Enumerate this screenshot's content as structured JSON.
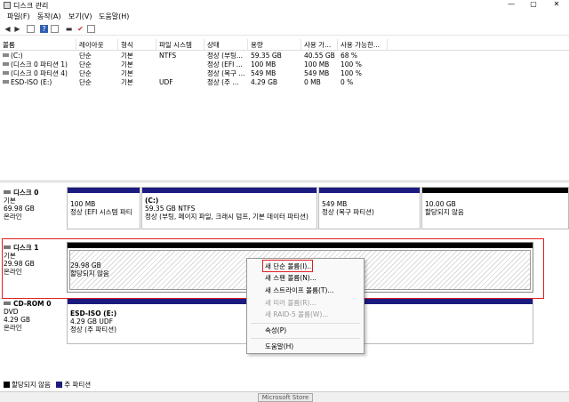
{
  "window": {
    "title": "디스크 관리",
    "minimize": "—",
    "maximize": "▢",
    "close": "✕"
  },
  "menu": [
    "파일(F)",
    "동작(A)",
    "보기(V)",
    "도움말(H)"
  ],
  "toolbar_icons": [
    "back-icon",
    "forward-icon",
    "grid-icon",
    "help-icon",
    "grid-icon",
    "properties-icon",
    "check-icon",
    "list-icon"
  ],
  "volume_table": {
    "headers": [
      "볼륨",
      "레이아웃",
      "형식",
      "파일 시스템",
      "상태",
      "용량",
      "사용 가...",
      "사용 가능한..."
    ],
    "rows": [
      [
        "(C:)",
        "단순",
        "기본",
        "NTFS",
        "정상 (부팅...",
        "59.35 GB",
        "40.55 GB",
        "68 %"
      ],
      [
        "(디스크 0 파티션 1)",
        "단순",
        "기본",
        "",
        "정상 (EFI ...",
        "100 MB",
        "100 MB",
        "100 %"
      ],
      [
        "(디스크 0 파티션 4)",
        "단순",
        "기본",
        "",
        "정상 (복구 ...",
        "549 MB",
        "549 MB",
        "100 %"
      ],
      [
        "ESD-ISO (E:)",
        "단순",
        "기본",
        "UDF",
        "정상 (주 ...",
        "4.29 GB",
        "0 MB",
        "0 %"
      ]
    ]
  },
  "disks": [
    {
      "name": "디스크 0",
      "type": "기본",
      "size": "69.98 GB",
      "status": "온라인",
      "partitions": [
        {
          "title": "",
          "size": "100 MB",
          "status": "정상 (EFI 시스템 파티"
        },
        {
          "title": "(C:)",
          "size": "59.35 GB NTFS",
          "status": "정상 (부팅, 페이지 파일, 크래시 덤프, 기본 데이터 파티션)"
        },
        {
          "title": "",
          "size": "549 MB",
          "status": "정상 (복구 파티션)"
        },
        {
          "title": "",
          "size": "10.00 GB",
          "status": "할당되지 않음"
        }
      ]
    },
    {
      "name": "디스크 1",
      "type": "기본",
      "size": "29.98 GB",
      "status": "온라인",
      "partitions": [
        {
          "title": "",
          "size": "29.98 GB",
          "status": "할당되지 않음"
        }
      ]
    },
    {
      "name": "CD-ROM 0",
      "type": "DVD",
      "size": "4.29 GB",
      "status": "온라인",
      "partitions": [
        {
          "title": "ESD-ISO  (E:)",
          "size": "4.29 GB UDF",
          "status": "정상 (주 파티션)"
        }
      ]
    }
  ],
  "context_menu": [
    {
      "label": "새 단순 볼륨(I)...",
      "enabled": true
    },
    {
      "label": "새 스팬 볼륨(N)...",
      "enabled": true
    },
    {
      "label": "새 스트라이프 볼륨(T)...",
      "enabled": true
    },
    {
      "label": "새 미러 볼륨(R)...",
      "enabled": false
    },
    {
      "label": "새 RAID-5 볼륨(W)...",
      "enabled": false
    },
    {
      "label": "속성(P)",
      "enabled": true
    },
    {
      "label": "도움말(H)",
      "enabled": true
    }
  ],
  "legend": [
    {
      "label": "할당되지 않음",
      "color": "#000000"
    },
    {
      "label": "주 파티션",
      "color": "#1c1c80"
    }
  ],
  "statusbar": {
    "store": "Microsoft Store"
  },
  "colors": {
    "primary_partition": "#1c1c80",
    "unallocated": "#000000",
    "highlight": "#e02020"
  }
}
